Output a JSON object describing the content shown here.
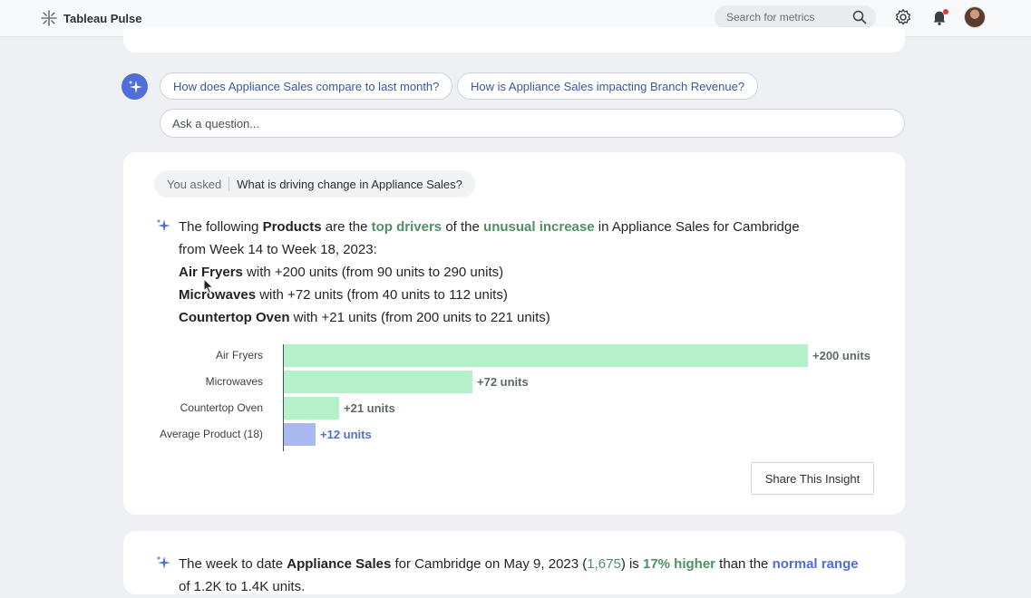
{
  "app": {
    "title": "Tableau Pulse"
  },
  "search": {
    "placeholder": "Search for metrics"
  },
  "suggestions": [
    "How does Appliance Sales compare to last month?",
    "How is Appliance Sales impacting Branch Revenue?"
  ],
  "ask": {
    "placeholder": "Ask a question..."
  },
  "insight_card": {
    "you_asked_label": "You asked",
    "question": "What is driving change in Appliance Sales?",
    "p1_a": "The following ",
    "p1_b": "Products",
    "p1_c": " are the ",
    "p1_d": "top drivers",
    "p1_e": " of the ",
    "p1_f": "unusual increase",
    "p1_g": " in Appliance Sales for Cambridge",
    "p1_h": "from Week 14 to Week 18, 2023:",
    "drivers": [
      {
        "name": "Air Fryers",
        "detail": " with +200 units (from 90 units to 290 units)"
      },
      {
        "name": "Microwaves",
        "detail": " with +72 units (from 40 units to 112 units)"
      },
      {
        "name": "Countertop Oven",
        "detail": " with +21 units (from 200 units to 221 units)"
      }
    ],
    "share_label": "Share This Insight"
  },
  "chart_data": {
    "type": "bar",
    "orientation": "horizontal",
    "categories": [
      "Air Fryers",
      "Microwaves",
      "Countertop Oven",
      "Average Product (18)"
    ],
    "values": [
      200,
      72,
      21,
      12
    ],
    "value_labels": [
      "+200 units",
      "+72 units",
      "+21 units",
      "+12 units"
    ],
    "colors": [
      "#b4f0c9",
      "#b4f0c9",
      "#b4f0c9",
      "#a9b9ef"
    ],
    "label_colors": [
      "#5c6b62",
      "#5c6b62",
      "#5c6b62",
      "#4f6ed8"
    ],
    "xlim": [
      0,
      200
    ]
  },
  "next_card": {
    "a": "The week to date ",
    "b": "Appliance Sales",
    "c": " for Cambridge on May 9, 2023 (",
    "d": "1,675",
    "e": ") is ",
    "f": "17% higher",
    "g": " than the ",
    "h": "normal range",
    "i": "of 1.2K to 1.4K units."
  }
}
